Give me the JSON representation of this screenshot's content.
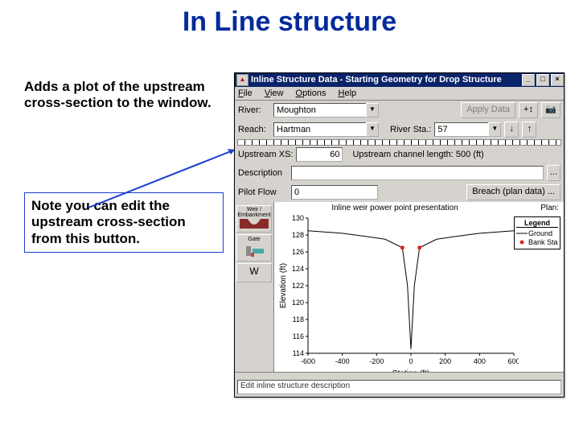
{
  "slide": {
    "title": "In Line structure",
    "para1": "Adds a plot of the upstream cross-section to the window.",
    "para2": "Note you can edit the upstream cross-section from this button."
  },
  "window": {
    "title": "Inline Structure Data - Starting Geometry for Drop Structure",
    "menus": {
      "file": "File",
      "view": "View",
      "options": "Options",
      "help": "Help"
    },
    "labels": {
      "river": "River:",
      "reach": "Reach:",
      "river_sta": "River Sta.:",
      "upstream_xs": "Upstream XS:",
      "upstream_len": "Upstream channel length: 500 (ft)",
      "description": "Description",
      "pilot_flow": "Pilot Flow"
    },
    "values": {
      "river": "Moughton",
      "reach": "Hartman",
      "river_sta": "57",
      "upstream_xs": "60",
      "description": "",
      "pilot_flow": "0"
    },
    "buttons": {
      "apply_data": "Apply Data",
      "breach": "Breach (plan data) ...",
      "ellipsis": "..."
    },
    "tools": {
      "weir": "Weir / Embankment",
      "gate": "Gate",
      "w": "W"
    },
    "plot": {
      "title": "Inline weir power point presentation",
      "plan_label": "Plan:",
      "xlabel": "Station (ft)",
      "ylabel": "Elevation (ft)",
      "legend": {
        "title": "Legend",
        "ground": "Ground",
        "banksta": "Bank Sta"
      }
    },
    "status": "Edit inline structure description"
  },
  "chart_data": {
    "type": "line",
    "title": "Inline weir power point presentation",
    "xlabel": "Station (ft)",
    "ylabel": "Elevation (ft)",
    "xlim": [
      -600,
      600
    ],
    "ylim": [
      114,
      130
    ],
    "xticks": [
      -600,
      -400,
      -200,
      0,
      200,
      400,
      600
    ],
    "yticks": [
      114,
      116,
      118,
      120,
      122,
      124,
      126,
      128,
      130
    ],
    "series": [
      {
        "name": "Ground",
        "color": "#000",
        "x": [
          -600,
          -400,
          -250,
          -150,
          -50,
          -20,
          0,
          20,
          50,
          150,
          250,
          400,
          600
        ],
        "y": [
          128.5,
          128.2,
          127.8,
          127.5,
          126.5,
          122,
          114.5,
          122,
          126.5,
          127.5,
          127.8,
          128.2,
          128.5
        ]
      }
    ],
    "bank_stations": [
      {
        "x": -50,
        "y": 126.5
      },
      {
        "x": 50,
        "y": 126.5
      }
    ]
  }
}
